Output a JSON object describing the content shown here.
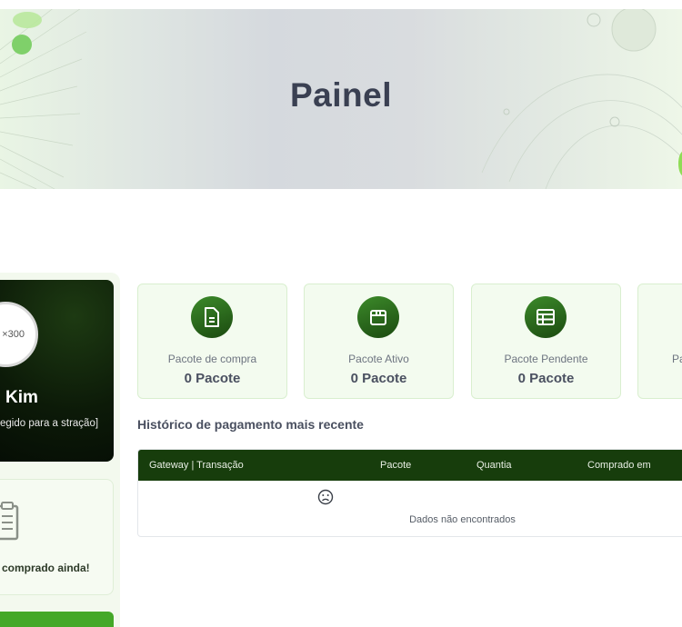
{
  "banner": {
    "title": "Painel"
  },
  "profile": {
    "avatar_text": "×300",
    "name": "Kim",
    "note": "egido para a stração]"
  },
  "empty_state": {
    "text": "comprado ainda!",
    "icon": "clipboard-icon"
  },
  "stats": [
    {
      "label": "Pacote de compra",
      "value": "0 Pacote",
      "icon": "document-icon"
    },
    {
      "label": "Pacote Ativo",
      "value": "0 Pacote",
      "icon": "box-icon"
    },
    {
      "label": "Pacote Pendente",
      "value": "0 Pacote",
      "icon": "table-icon"
    },
    {
      "label": "Pa",
      "value": "",
      "icon": ""
    }
  ],
  "history": {
    "title": "Histórico de pagamento mais recente",
    "columns": [
      "Gateway | Transação",
      "Pacote",
      "Quantia",
      "Comprado em"
    ],
    "empty_text": "Dados não encontrados",
    "empty_icon": "sad-face-icon"
  },
  "colors": {
    "accent_dark": "#173d0c",
    "accent_green": "#44a828",
    "card_bg": "#f3fbef"
  }
}
